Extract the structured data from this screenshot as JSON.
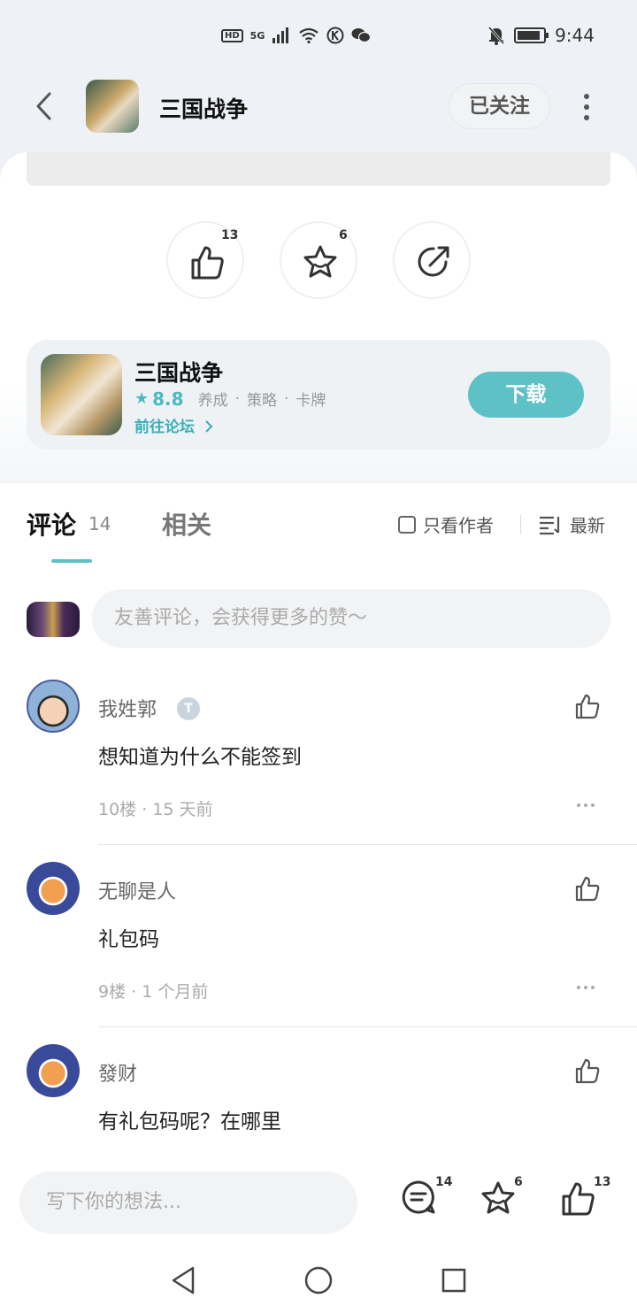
{
  "status_bar": {
    "hd": "HD",
    "network": "5G",
    "time": "9:44",
    "battery_level": 0.9
  },
  "header": {
    "title": "三国战争",
    "follow_label": "已关注"
  },
  "actions": {
    "like_count": "13",
    "favorite_count": "6"
  },
  "game_card": {
    "name": "三国战争",
    "rating": "8.8",
    "tags": [
      "养成",
      "策略",
      "卡牌"
    ],
    "tag_separator": "·",
    "forum_link": "前往论坛",
    "download_label": "下载"
  },
  "comment_tabs": {
    "comments_label": "评论",
    "comments_count": "14",
    "related_label": "相关",
    "author_only_label": "只看作者",
    "sort_label": "最新"
  },
  "comment_input": {
    "placeholder": "友善评论，会获得更多的赞～"
  },
  "comments": [
    {
      "username": "我姓郭",
      "badge": "T",
      "text": "想知道为什么不能签到",
      "meta": "10楼 · 15 天前"
    },
    {
      "username": "无聊是人",
      "badge": "",
      "text": "礼包码",
      "meta": "9楼 · 1 个月前"
    },
    {
      "username": "發财",
      "badge": "",
      "text": "有礼包码呢？在哪里",
      "meta": ""
    }
  ],
  "bottom_bar": {
    "placeholder": "写下你的想法...",
    "comment_count": "14",
    "favorite_count": "6",
    "like_count": "13"
  },
  "colors": {
    "accent": "#5ec1c6",
    "background": "#eef1f5"
  }
}
